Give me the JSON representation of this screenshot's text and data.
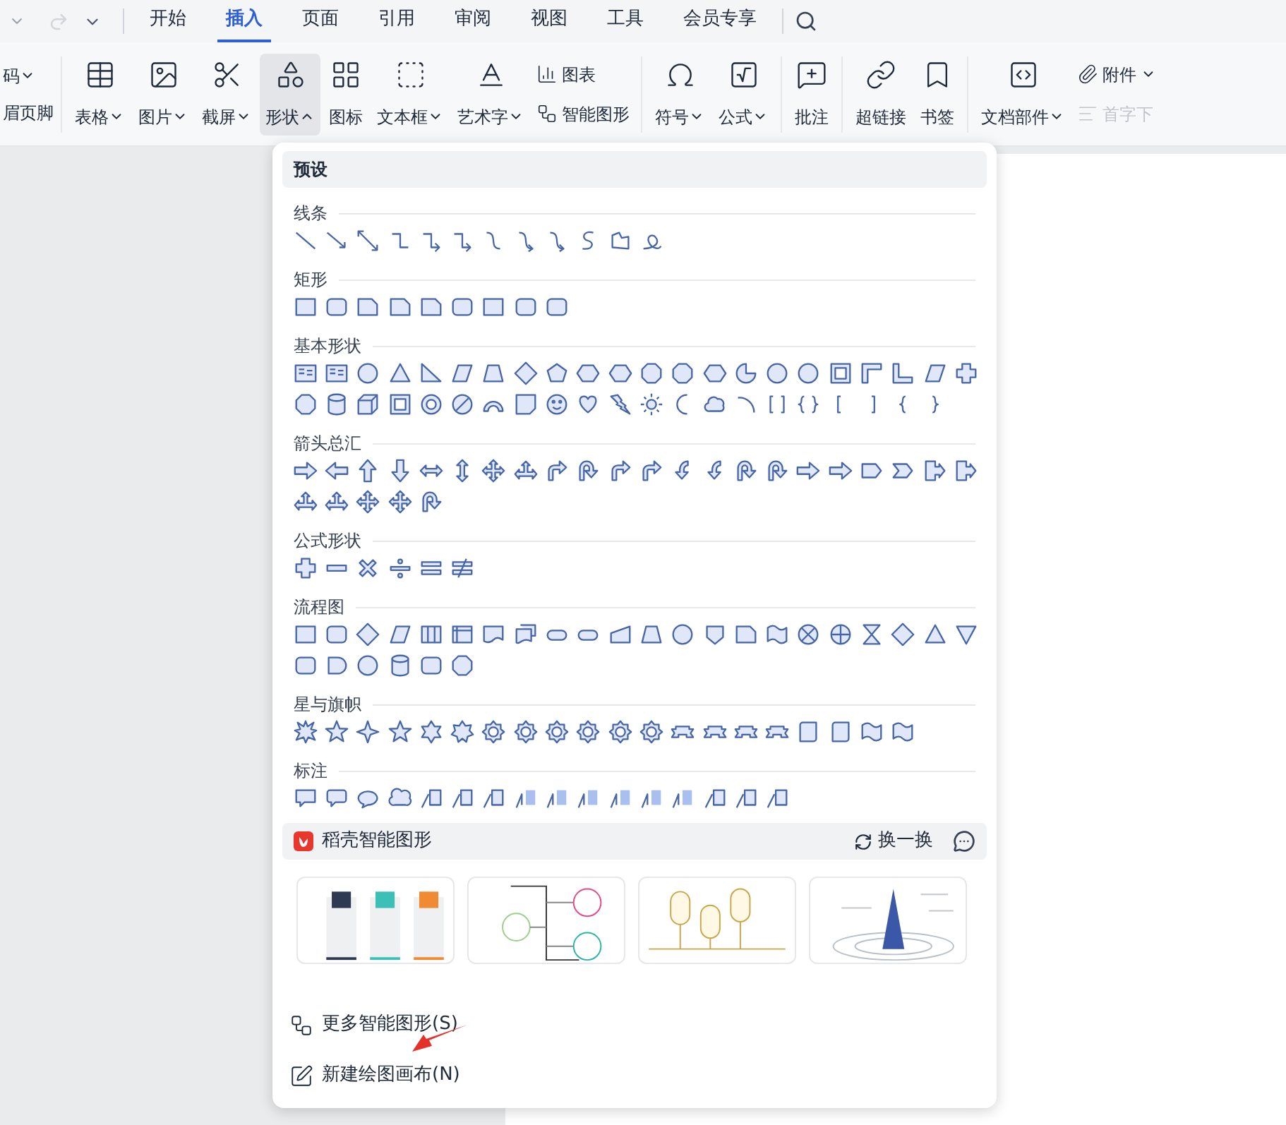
{
  "tabs": [
    {
      "label": "开始",
      "selected": false
    },
    {
      "label": "插入",
      "selected": true
    },
    {
      "label": "页面",
      "selected": false
    },
    {
      "label": "引用",
      "selected": false
    },
    {
      "label": "审阅",
      "selected": false
    },
    {
      "label": "视图",
      "selected": false
    },
    {
      "label": "工具",
      "selected": false
    },
    {
      "label": "会员专享",
      "selected": false
    }
  ],
  "ribbon": [
    {
      "items": [
        {
          "kind": "cut",
          "top": "码",
          "bottom": "眉页脚",
          "has_menu": true
        }
      ]
    },
    {
      "items": [
        {
          "kind": "large",
          "label": "表格",
          "has_menu": true,
          "expanded": false,
          "disabled": false
        },
        {
          "kind": "large",
          "label": "图片",
          "has_menu": true,
          "expanded": false,
          "disabled": false
        },
        {
          "kind": "large",
          "label": "截屏",
          "has_menu": true,
          "expanded": false,
          "disabled": false
        },
        {
          "kind": "large",
          "label": "形状",
          "has_menu": true,
          "expanded": true,
          "disabled": false
        },
        {
          "kind": "large",
          "label": "图标",
          "has_menu": false,
          "expanded": false,
          "disabled": false
        },
        {
          "kind": "large",
          "label": "文本框",
          "has_menu": true,
          "expanded": false,
          "disabled": false
        },
        {
          "kind": "large",
          "label": "艺术字",
          "has_menu": true,
          "expanded": false,
          "disabled": false
        },
        {
          "kind": "small",
          "label": "图表",
          "has_menu": false,
          "expanded": false,
          "disabled": false
        },
        {
          "kind": "small",
          "label": "智能图形",
          "has_menu": false,
          "expanded": false,
          "disabled": false
        }
      ]
    },
    {
      "items": [
        {
          "kind": "large",
          "label": "符号",
          "has_menu": true,
          "expanded": false,
          "disabled": false
        },
        {
          "kind": "large",
          "label": "公式",
          "has_menu": true,
          "expanded": false,
          "disabled": false
        }
      ]
    },
    {
      "items": [
        {
          "kind": "large",
          "label": "批注",
          "has_menu": false,
          "expanded": false,
          "disabled": false
        }
      ]
    },
    {
      "items": [
        {
          "kind": "large",
          "label": "超链接",
          "has_menu": false,
          "expanded": false,
          "disabled": false
        },
        {
          "kind": "large",
          "label": "书签",
          "has_menu": false,
          "expanded": false,
          "disabled": false
        }
      ]
    },
    {
      "items": [
        {
          "kind": "large",
          "label": "文档部件",
          "has_menu": true,
          "expanded": false,
          "disabled": false
        },
        {
          "kind": "small",
          "label": "附件",
          "has_menu": true,
          "expanded": false,
          "disabled": false
        },
        {
          "kind": "small",
          "label": "首字下",
          "has_menu": false,
          "expanded": false,
          "disabled": true
        }
      ]
    }
  ],
  "menu": {
    "header": "预设",
    "sections": [
      {
        "title": "线条",
        "shapes": [
          {
            "kind": "line"
          },
          {
            "kind": "arrow"
          },
          {
            "kind": "double-arrow"
          },
          {
            "kind": "elbow"
          },
          {
            "kind": "elbow-arrow"
          },
          {
            "kind": "elbow-arrow"
          },
          {
            "kind": "curve"
          },
          {
            "kind": "curve-arrow"
          },
          {
            "kind": "curve-arrow"
          },
          {
            "kind": "s-curve"
          },
          {
            "kind": "freeform"
          },
          {
            "kind": "scribble"
          }
        ]
      },
      {
        "title": "矩形",
        "shapes": [
          {
            "kind": "rect"
          },
          {
            "kind": "round-rect"
          },
          {
            "kind": "snip-rect"
          },
          {
            "kind": "snip-rect"
          },
          {
            "kind": "snip-rect"
          },
          {
            "kind": "round-rect"
          },
          {
            "kind": "rect"
          },
          {
            "kind": "round-rect"
          },
          {
            "kind": "round-rect"
          }
        ]
      },
      {
        "title": "基本形状",
        "shapes": [
          {
            "kind": "text-box"
          },
          {
            "kind": "text-box"
          },
          {
            "kind": "circle"
          },
          {
            "kind": "triangle"
          },
          {
            "kind": "right-triangle"
          },
          {
            "kind": "parallelogram"
          },
          {
            "kind": "trapezoid"
          },
          {
            "kind": "diamond"
          },
          {
            "kind": "pentagon"
          },
          {
            "kind": "hexagon"
          },
          {
            "kind": "hexagon"
          },
          {
            "kind": "octagon"
          },
          {
            "kind": "octagon"
          },
          {
            "kind": "hexagon"
          },
          {
            "kind": "pie"
          },
          {
            "kind": "circle"
          },
          {
            "kind": "circle"
          },
          {
            "kind": "frame"
          },
          {
            "kind": "corner"
          },
          {
            "kind": "l-shape"
          },
          {
            "kind": "parallelogram"
          },
          {
            "kind": "plus"
          },
          {
            "kind": "octagon"
          },
          {
            "kind": "cylinder"
          },
          {
            "kind": "cube"
          },
          {
            "kind": "frame"
          },
          {
            "kind": "donut"
          },
          {
            "kind": "no-symbol"
          },
          {
            "kind": "arc-block"
          },
          {
            "kind": "fold"
          },
          {
            "kind": "smiley"
          },
          {
            "kind": "heart"
          },
          {
            "kind": "lightning"
          },
          {
            "kind": "sun"
          },
          {
            "kind": "moon"
          },
          {
            "kind": "cloud"
          },
          {
            "kind": "arc"
          },
          {
            "kind": "bracket-pair"
          },
          {
            "kind": "brace-pair"
          },
          {
            "kind": "bracket-left"
          },
          {
            "kind": "bracket-right"
          },
          {
            "kind": "brace-left"
          },
          {
            "kind": "brace-right"
          }
        ]
      },
      {
        "title": "箭头总汇",
        "shapes": [
          {
            "kind": "arrow-right"
          },
          {
            "kind": "arrow-left"
          },
          {
            "kind": "arrow-up"
          },
          {
            "kind": "arrow-down"
          },
          {
            "kind": "arrow-lr"
          },
          {
            "kind": "arrow-ud"
          },
          {
            "kind": "arrow-quad"
          },
          {
            "kind": "arrow-tri"
          },
          {
            "kind": "bent-arrow"
          },
          {
            "kind": "u-turn"
          },
          {
            "kind": "bent-arrow"
          },
          {
            "kind": "bent-arrow"
          },
          {
            "kind": "curved-arrow"
          },
          {
            "kind": "curved-arrow"
          },
          {
            "kind": "u-turn"
          },
          {
            "kind": "u-turn"
          },
          {
            "kind": "arrow-right"
          },
          {
            "kind": "arrow-right"
          },
          {
            "kind": "pentagon-arrow"
          },
          {
            "kind": "chevron"
          },
          {
            "kind": "arrow-callout"
          },
          {
            "kind": "arrow-callout"
          },
          {
            "kind": "arrow-tri"
          },
          {
            "kind": "arrow-tri"
          },
          {
            "kind": "arrow-quad"
          },
          {
            "kind": "arrow-quad"
          },
          {
            "kind": "u-turn"
          }
        ]
      },
      {
        "title": "公式形状",
        "shapes": [
          {
            "kind": "plus"
          },
          {
            "kind": "minus"
          },
          {
            "kind": "times"
          },
          {
            "kind": "divide"
          },
          {
            "kind": "equal"
          },
          {
            "kind": "not-equal"
          }
        ]
      },
      {
        "title": "流程图",
        "shapes": [
          {
            "kind": "rect"
          },
          {
            "kind": "round-rect"
          },
          {
            "kind": "diamond"
          },
          {
            "kind": "parallelogram"
          },
          {
            "kind": "columns"
          },
          {
            "kind": "internal"
          },
          {
            "kind": "document"
          },
          {
            "kind": "documents"
          },
          {
            "kind": "terminator"
          },
          {
            "kind": "terminator"
          },
          {
            "kind": "manual-input"
          },
          {
            "kind": "trapezoid"
          },
          {
            "kind": "circle"
          },
          {
            "kind": "shield"
          },
          {
            "kind": "snip-rect"
          },
          {
            "kind": "wave"
          },
          {
            "kind": "cross-circle"
          },
          {
            "kind": "plus-circle"
          },
          {
            "kind": "hourglass"
          },
          {
            "kind": "diamond"
          },
          {
            "kind": "triangle"
          },
          {
            "kind": "triangle-down"
          },
          {
            "kind": "round-rect"
          },
          {
            "kind": "delay"
          },
          {
            "kind": "circle"
          },
          {
            "kind": "cylinder"
          },
          {
            "kind": "round-rect"
          },
          {
            "kind": "octagon"
          }
        ]
      },
      {
        "title": "星与旗帜",
        "shapes": [
          {
            "kind": "burst"
          },
          {
            "kind": "star5"
          },
          {
            "kind": "star4"
          },
          {
            "kind": "star5"
          },
          {
            "kind": "star6"
          },
          {
            "kind": "star7"
          },
          {
            "kind": "badge"
          },
          {
            "kind": "badge"
          },
          {
            "kind": "badge"
          },
          {
            "kind": "badge"
          },
          {
            "kind": "badge"
          },
          {
            "kind": "badge"
          },
          {
            "kind": "ribbon"
          },
          {
            "kind": "ribbon"
          },
          {
            "kind": "ribbon"
          },
          {
            "kind": "ribbon"
          },
          {
            "kind": "scroll"
          },
          {
            "kind": "scroll"
          },
          {
            "kind": "wave"
          },
          {
            "kind": "wave"
          }
        ]
      },
      {
        "title": "标注",
        "shapes": [
          {
            "kind": "callout-rect"
          },
          {
            "kind": "callout-round"
          },
          {
            "kind": "callout-oval"
          },
          {
            "kind": "callout-cloud"
          },
          {
            "kind": "callout-line"
          },
          {
            "kind": "callout-line"
          },
          {
            "kind": "callout-line"
          },
          {
            "kind": "callout-bar"
          },
          {
            "kind": "callout-bar"
          },
          {
            "kind": "callout-bar"
          },
          {
            "kind": "callout-bar"
          },
          {
            "kind": "callout-bar"
          },
          {
            "kind": "callout-bar"
          },
          {
            "kind": "callout-line"
          },
          {
            "kind": "callout-line"
          },
          {
            "kind": "callout-line"
          }
        ]
      }
    ],
    "smart": {
      "title": "稻壳智能图形",
      "refresh": "换一换",
      "thumbnails": [
        {
          "kind": "cards"
        },
        {
          "kind": "branches"
        },
        {
          "kind": "pins"
        },
        {
          "kind": "tower"
        }
      ]
    },
    "actions": [
      {
        "label": "更多智能图形(S)"
      },
      {
        "label": "新建绘图画布(N)"
      }
    ]
  }
}
